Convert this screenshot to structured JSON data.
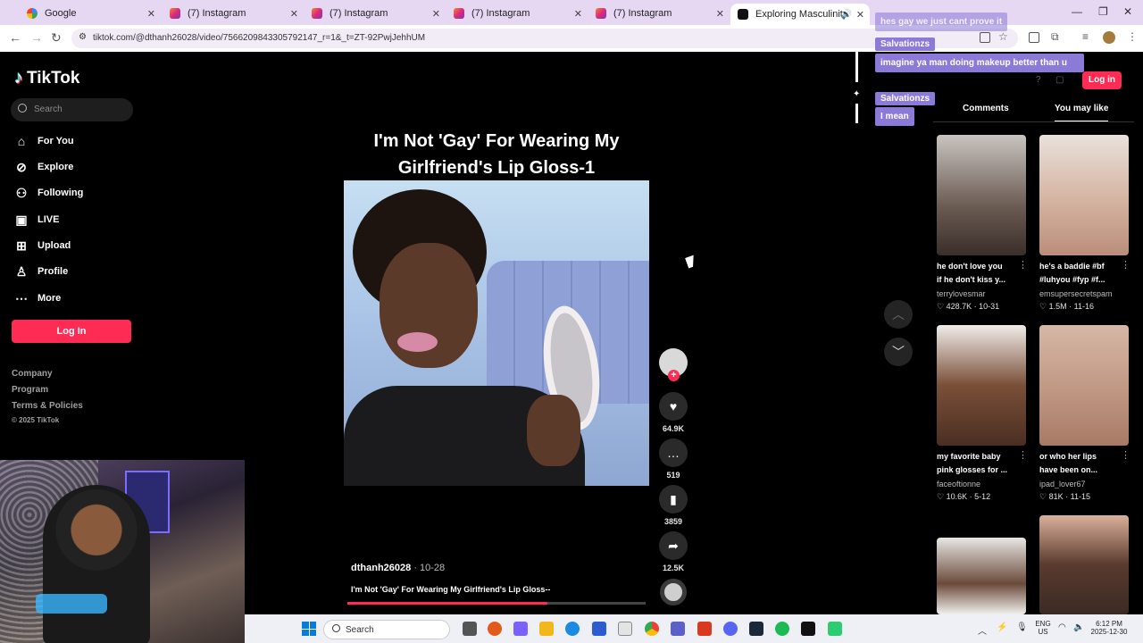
{
  "browser": {
    "tabs": [
      {
        "title": "Google",
        "favicon": "google-icon"
      },
      {
        "title": "(7) Instagram",
        "favicon": "instagram-icon"
      },
      {
        "title": "(7) Instagram",
        "favicon": "instagram-icon"
      },
      {
        "title": "(7) Instagram",
        "favicon": "instagram-icon"
      },
      {
        "title": "(7) Instagram",
        "favicon": "instagram-icon"
      },
      {
        "title": "Exploring Masculinity: Mak",
        "favicon": "tiktok-icon"
      }
    ],
    "url": "tiktok.com/@dthanh26028/video/7566209843305792147_r=1&_t=ZT-92PwjJehhUM"
  },
  "sidebar": {
    "brand": "TikTok",
    "search_placeholder": "Search",
    "items": [
      {
        "label": "For You",
        "icon": "home-icon"
      },
      {
        "label": "Explore",
        "icon": "compass-icon"
      },
      {
        "label": "Following",
        "icon": "users-icon"
      },
      {
        "label": "LIVE",
        "icon": "live-icon"
      },
      {
        "label": "Upload",
        "icon": "upload-icon"
      },
      {
        "label": "Profile",
        "icon": "profile-icon"
      },
      {
        "label": "More",
        "icon": "more-icon"
      }
    ],
    "login_label": "Log In",
    "footer": [
      "Company",
      "Program",
      "Terms & Policies",
      "© 2025 TikTok"
    ]
  },
  "video": {
    "title_line1": "I'm Not 'Gay' For Wearing My",
    "title_line2": "Girlfriend's Lip Gloss-1",
    "author": "dthanh26028",
    "date": "· 10-28",
    "caption": "I'm Not 'Gay' For Wearing My Girlfriend's Lip Gloss--",
    "progress": 0.67,
    "stats": {
      "likes": "64.9K",
      "comments": "519",
      "saves": "3859",
      "shares": "12.5K"
    }
  },
  "chat": [
    {
      "type": "msg",
      "text": "hes gay we just cant prove it",
      "faded": true
    },
    {
      "type": "name",
      "text": "Salvationzs"
    },
    {
      "type": "msg",
      "text": "imagine ya man doing makeup better than u"
    },
    {
      "type": "name",
      "text": "Salvationzs"
    },
    {
      "type": "msg",
      "text": "I mean"
    }
  ],
  "right_panel": {
    "login_label": "Log in",
    "tabs": [
      "Comments",
      "You may like"
    ],
    "cards": [
      {
        "title_line1": "he don't love you",
        "title_line2": "if he don't kiss y...",
        "user": "terrylovesmar",
        "likes": "428.7K",
        "date": "10-31"
      },
      {
        "title_line1": "he's a baddie #bf",
        "title_line2": "#luhyou #fyp #f...",
        "user": "emsupersecretspam",
        "likes": "1.5M",
        "date": "11-16"
      },
      {
        "title_line1": "my favorite baby",
        "title_line2": "pink glosses for ...",
        "user": "faceoftionne",
        "likes": "10.6K",
        "date": "5-12"
      },
      {
        "title_line1": "or who her lips",
        "title_line2": "have been on...",
        "user": "ipad_lover67",
        "likes": "81K",
        "date": "11-15"
      }
    ]
  },
  "taskbar": {
    "search_label": "Search",
    "lang_line1": "ENG",
    "lang_line2": "US",
    "time": "6:12 PM",
    "date": "2025-12-30"
  },
  "colors": {
    "accent": "#fe2c55",
    "chat_bg": "#8c7ad8",
    "tab_strip": "#e6d7f3"
  }
}
